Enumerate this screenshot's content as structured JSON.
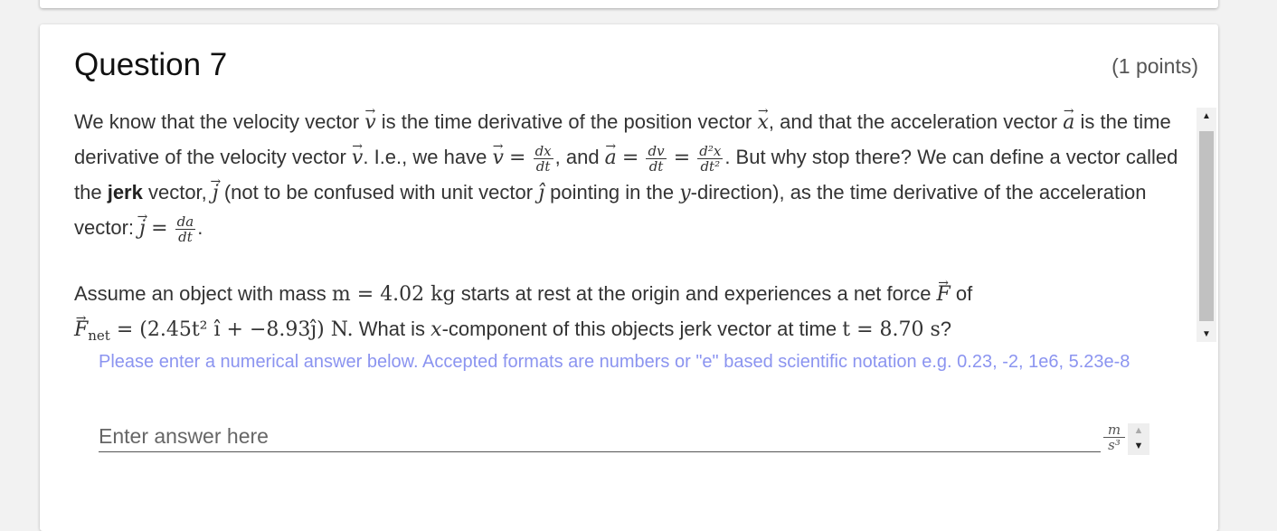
{
  "question": {
    "title": "Question 7",
    "points": "(1 points)",
    "p1": {
      "t1": "We know that the velocity vector ",
      "v": "v",
      "t2": " is the time derivative of the position vector ",
      "x": "x",
      "t3": ", and that the acceleration vector ",
      "a": "a",
      "t4": " is the time derivative of the velocity vector ",
      "t5": ". I.e., we have ",
      "eq": "=",
      "dx": "dx",
      "dt": "dt",
      "t6": ", and ",
      "dv": "dv",
      "d2x": "d²x",
      "dt2": "dt²",
      "t7": ".  But why stop there?  We can define a vector called the ",
      "jerk": "jerk",
      "t8": " vector, ",
      "j": "j",
      "t9": " (not to be confused with unit vector ",
      "jhat": "ĵ",
      "t10": " pointing in the ",
      "y": "y",
      "t11": "-direction), as the time derivative of the acceleration vector: ",
      "da": "da",
      "t12": "."
    },
    "p2": {
      "t1": "Assume an object with mass ",
      "mass_expr": "m = 4.02 kg",
      "t2": " starts at rest at the origin and experiences a net force ",
      "F": "F",
      "t3": " of ",
      "Fnet": "F",
      "net": "net",
      "force_expr": " = (2.45t² î + −8.93ĵ) N.",
      "t4": "  What is ",
      "xc": "x",
      "t5": "-component of this objects jerk vector at time ",
      "time_expr": "t = 8.70 s",
      "t6": "?"
    },
    "hint": "Please enter a numerical answer below. Accepted formats are numbers or \"e\" based scientific notation e.g. 0.23, -2, 1e6, 5.23e-8",
    "answer": {
      "placeholder": "Enter answer here",
      "value": "",
      "unit_num": "m",
      "unit_den": "s³"
    }
  }
}
